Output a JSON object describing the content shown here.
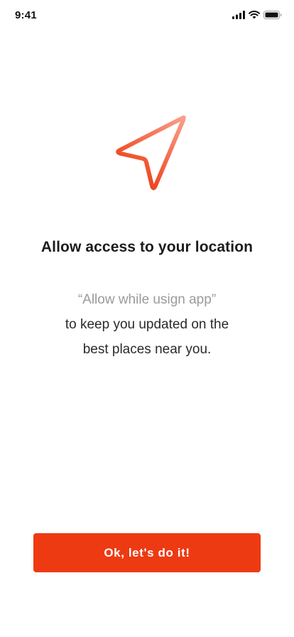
{
  "status_bar": {
    "time": "9:41",
    "icons": [
      "cellular-signal-icon",
      "wifi-icon",
      "battery-icon"
    ]
  },
  "main": {
    "icon": "location-arrow-icon",
    "title": "Allow access to your location",
    "description": {
      "quote": "“Allow while usign app”",
      "line1": "to keep you updated on the",
      "line2": "best places near you."
    }
  },
  "cta": {
    "label": "Ok, let's do it!"
  },
  "colors": {
    "accent": "#EE3A12",
    "icon_gradient_start": "#F9A08A",
    "icon_gradient_end": "#EE3A12",
    "muted_text": "#9A9A9A"
  }
}
